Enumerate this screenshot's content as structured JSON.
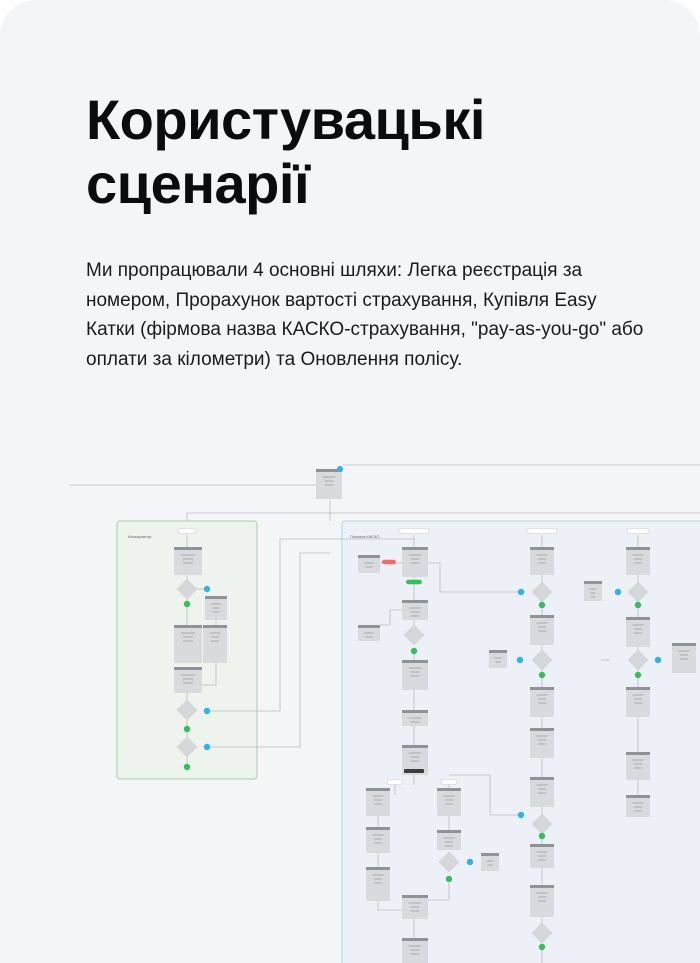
{
  "page": {
    "title": "Користувацькі сценарії",
    "description": "Ми пропрацювали 4 основні шляхи: Легка реєстрація за номером, Прорахунок вартості страхування, Купівля Easy Катки (фірмова назва КАСКО-страхування, \"pay-as-you-go\" або оплати за кілометри) та Оновлення полісу."
  },
  "colors": {
    "card_bg": "#f4f5f7",
    "title": "#0b0c0e",
    "text": "#1a1b1e",
    "calculator_group_bg": "#eef3ee",
    "calculator_group_border": "#a9cfa9",
    "kasko_group_bg": "#edf1f7",
    "kasko_group_border": "#b4d2e6",
    "yes_badge": "#33c05a",
    "no_badge": "#2fb3e8",
    "error_badge": "#f26b6b"
  },
  "diagram": {
    "groups": [
      {
        "name": "calculator-group",
        "label": "Калькулятор"
      },
      {
        "name": "kasko-group",
        "label": "Покупка КАСКО"
      }
    ]
  }
}
